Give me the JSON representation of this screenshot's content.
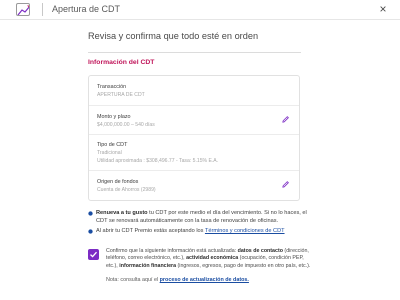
{
  "header": {
    "title": "Apertura de CDT",
    "close_glyph": "×"
  },
  "page": {
    "heading": "Revisa y confirma que todo esté en orden",
    "section_title": "Información del CDT"
  },
  "card": {
    "rows": [
      {
        "label": "Transacción",
        "value": "APERTURA DE CDT",
        "editable": false
      },
      {
        "label": "Monto y plazo",
        "value": "$4,000,000.00 – 540 días",
        "editable": true
      },
      {
        "label": "Tipo de CDT",
        "value": "Tradicional",
        "value2": "Utilidad aproximada : $308,496.77 - Tasa: 5.15% E.A.",
        "editable": false
      },
      {
        "label": "Origen de fondos",
        "value": "Cuenta de Ahorros (2989)",
        "editable": true
      }
    ]
  },
  "notes": {
    "renewal_bold": "Renueva a tu gusto",
    "renewal_text": " tu CDT por este medio el día del vencimiento. Si no lo haces, el CDT se renovará automáticamente con la tasa de renovación de oficinas.",
    "terms_text": "Al abrir tu CDT Premio estás aceptando los ",
    "terms_link": "Términos y condiciones de CDT"
  },
  "confirmation": {
    "checked": true,
    "t1": "Confirmo que la siguiente información está actualizada: ",
    "b1": "datos de contacto",
    "t2": " (dirección, teléfono, correo electrónico, etc.), ",
    "b2": "actividad económica",
    "t3": " (ocupación, condición PEP, etc.), ",
    "b3": "información financiera",
    "t4": " (ingresos, egresos, pago de impuesto en otro país, etc.).",
    "note_text": "Nota: consulta aquí el ",
    "note_link": "proceso de actualización de datos."
  },
  "colors": {
    "accent": "#c0155a",
    "checkbox": "#7c2cc4",
    "link": "#1a4da2",
    "icon": "#7c2cc4"
  },
  "icons": {
    "logo": "chart-trend-icon",
    "close": "close-icon",
    "edit": "pencil-icon",
    "info": "info-icon",
    "check": "check-icon"
  }
}
